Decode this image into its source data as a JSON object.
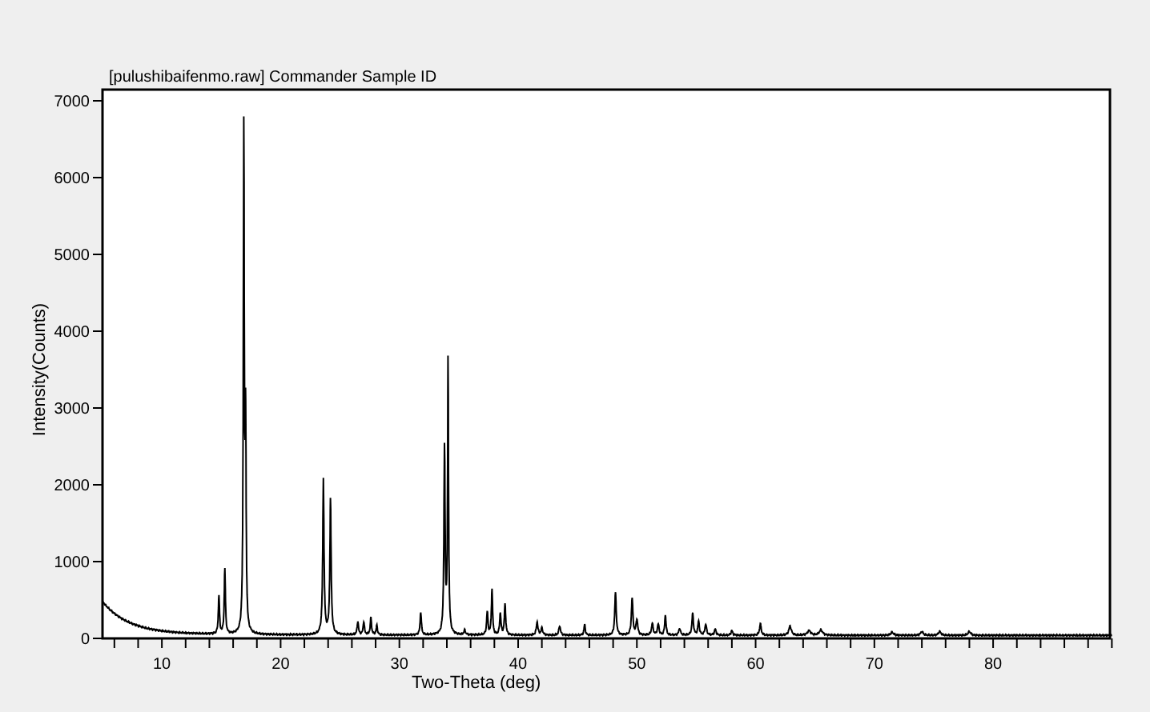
{
  "plot": {
    "title": "[pulushibaifenmo.raw] Commander Sample ID",
    "xlabel": "Two-Theta (deg)",
    "ylabel": "Intensity(Counts)",
    "xticks": [
      "10",
      "20",
      "30",
      "40",
      "50",
      "60",
      "70",
      "80"
    ],
    "yticks": [
      "7000",
      "6000",
      "5000",
      "4000",
      "3000",
      "2000",
      "1000",
      "0"
    ]
  }
}
